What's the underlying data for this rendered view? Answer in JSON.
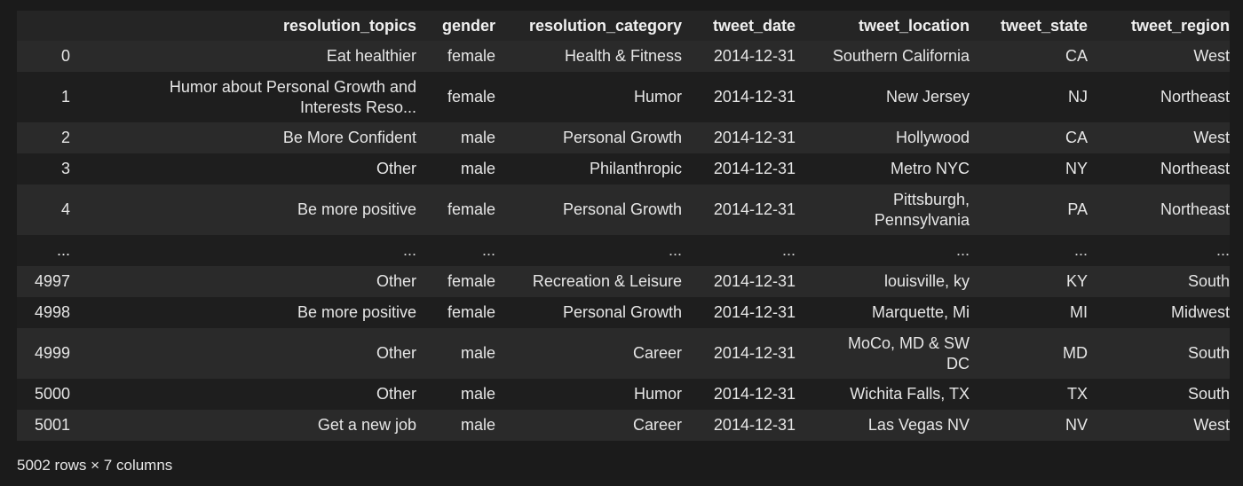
{
  "table": {
    "columns": [
      "resolution_topics",
      "gender",
      "resolution_category",
      "tweet_date",
      "tweet_location",
      "tweet_state",
      "tweet_region"
    ],
    "rows": [
      {
        "index": "0",
        "cells": [
          "Eat healthier",
          "female",
          "Health & Fitness",
          "2014-12-31",
          "Southern California",
          "CA",
          "West"
        ]
      },
      {
        "index": "1",
        "cells": [
          "Humor about Personal Growth and Interests Reso...",
          "female",
          "Humor",
          "2014-12-31",
          "New Jersey",
          "NJ",
          "Northeast"
        ]
      },
      {
        "index": "2",
        "cells": [
          "Be More Confident",
          "male",
          "Personal Growth",
          "2014-12-31",
          "Hollywood",
          "CA",
          "West"
        ]
      },
      {
        "index": "3",
        "cells": [
          "Other",
          "male",
          "Philanthropic",
          "2014-12-31",
          "Metro NYC",
          "NY",
          "Northeast"
        ]
      },
      {
        "index": "4",
        "cells": [
          "Be more positive",
          "female",
          "Personal Growth",
          "2014-12-31",
          "Pittsburgh, Pennsylvania",
          "PA",
          "Northeast"
        ]
      },
      {
        "index": "...",
        "cells": [
          "...",
          "...",
          "...",
          "...",
          "...",
          "...",
          "..."
        ]
      },
      {
        "index": "4997",
        "cells": [
          "Other",
          "female",
          "Recreation & Leisure",
          "2014-12-31",
          "louisville, ky",
          "KY",
          "South"
        ]
      },
      {
        "index": "4998",
        "cells": [
          "Be more positive",
          "female",
          "Personal Growth",
          "2014-12-31",
          "Marquette, Mi",
          "MI",
          "Midwest"
        ]
      },
      {
        "index": "4999",
        "cells": [
          "Other",
          "male",
          "Career",
          "2014-12-31",
          "MoCo, MD & SW DC",
          "MD",
          "South"
        ]
      },
      {
        "index": "5000",
        "cells": [
          "Other",
          "male",
          "Humor",
          "2014-12-31",
          "Wichita Falls, TX",
          "TX",
          "South"
        ]
      },
      {
        "index": "5001",
        "cells": [
          "Get a new job",
          "male",
          "Career",
          "2014-12-31",
          "Las Vegas NV",
          "NV",
          "West"
        ]
      }
    ]
  },
  "footer": {
    "shape": "5002 rows × 7 columns"
  }
}
